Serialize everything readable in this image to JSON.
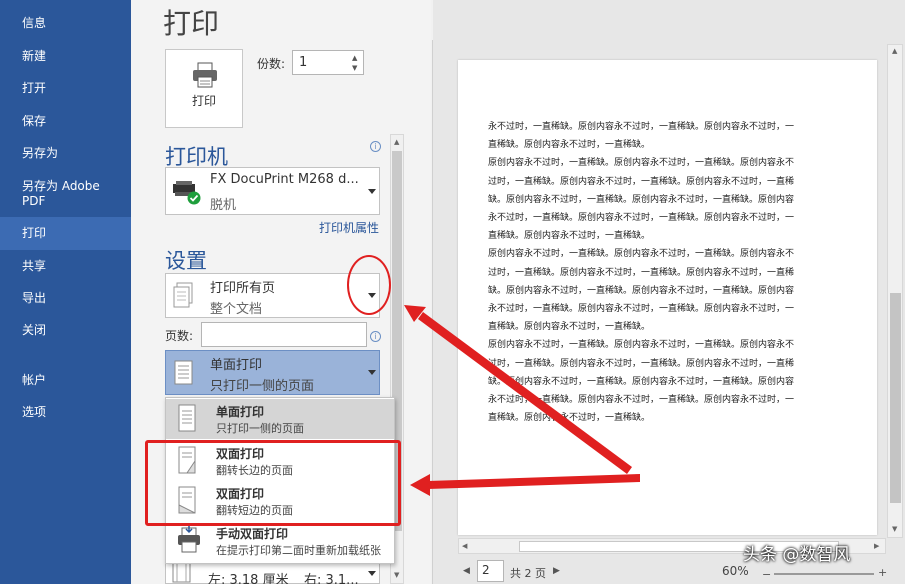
{
  "sidebar": {
    "items": [
      {
        "label": "信息"
      },
      {
        "label": "新建"
      },
      {
        "label": "打开"
      },
      {
        "label": "保存"
      },
      {
        "label": "另存为"
      },
      {
        "label": "另存为 Adobe PDF"
      },
      {
        "label": "打印"
      },
      {
        "label": "共享"
      },
      {
        "label": "导出"
      },
      {
        "label": "关闭"
      },
      {
        "label": "帐户"
      },
      {
        "label": "选项"
      }
    ]
  },
  "print": {
    "title": "打印",
    "button_label": "打印",
    "copies_label": "份数:",
    "copies_value": "1"
  },
  "printer": {
    "heading": "打印机",
    "name": "FX DocuPrint M268 d...",
    "status": "脱机",
    "properties_link": "打印机属性"
  },
  "settings": {
    "heading": "设置",
    "range": {
      "title": "打印所有页",
      "subtitle": "整个文档"
    },
    "pages_label": "页数:",
    "pages_value": "",
    "sides": {
      "title": "单面打印",
      "subtitle": "只打印一侧的页面"
    },
    "margins": {
      "left": "左: 3.18 厘米",
      "right": "右: 3.1..."
    }
  },
  "menu": {
    "items": [
      {
        "title": "单面打印",
        "subtitle": "只打印一侧的页面"
      },
      {
        "title": "双面打印",
        "subtitle": "翻转长边的页面"
      },
      {
        "title": "双面打印",
        "subtitle": "翻转短边的页面"
      },
      {
        "title": "手动双面打印",
        "subtitle": "在提示打印第二面时重新加载纸张"
      }
    ]
  },
  "preview": {
    "lines": [
      "永不过时，一直稀缺。原创内容永不过时，一直稀缺。原创内容永不过时，一",
      "直稀缺。原创内容永不过时，一直稀缺。",
      "原创内容永不过时，一直稀缺。原创内容永不过时，一直稀缺。原创内容永不",
      "过时，一直稀缺。原创内容永不过时，一直稀缺。原创内容永不过时，一直稀",
      "缺。原创内容永不过时，一直稀缺。原创内容永不过时，一直稀缺。原创内容",
      "永不过时，一直稀缺。原创内容永不过时，一直稀缺。原创内容永不过时，一",
      "直稀缺。原创内容永不过时，一直稀缺。",
      "原创内容永不过时，一直稀缺。原创内容永不过时，一直稀缺。原创内容永不",
      "过时，一直稀缺。原创内容永不过时，一直稀缺。原创内容永不过时，一直稀",
      "缺。原创内容永不过时，一直稀缺。原创内容永不过时，一直稀缺。原创内容",
      "永不过时，一直稀缺。原创内容永不过时，一直稀缺。原创内容永不过时，一",
      "直稀缺。原创内容永不过时，一直稀缺。",
      "原创内容永不过时，一直稀缺。原创内容永不过时，一直稀缺。原创内容永不",
      "过时，一直稀缺。原创内容永不过时，一直稀缺。原创内容永不过时，一直稀",
      "缺。原创内容永不过时，一直稀缺。原创内容永不过时，一直稀缺。原创内容",
      "永不过时，一直稀缺。原创内容永不过时，一直稀缺。原创内容永不过时，一",
      "直稀缺。原创内容永不过时，一直稀缺。"
    ],
    "page_value": "2",
    "page_total": "共 2 页",
    "zoom": "60%"
  },
  "watermark": "头条 @数智风",
  "colors": {
    "sidebar": "#2b579a",
    "sidebar_active": "#3c6bb3",
    "accent": "#2b579a",
    "annotation": "#e02020",
    "menu_selected": "#d5d5d5",
    "sides_selected": "#9ab3d9"
  }
}
